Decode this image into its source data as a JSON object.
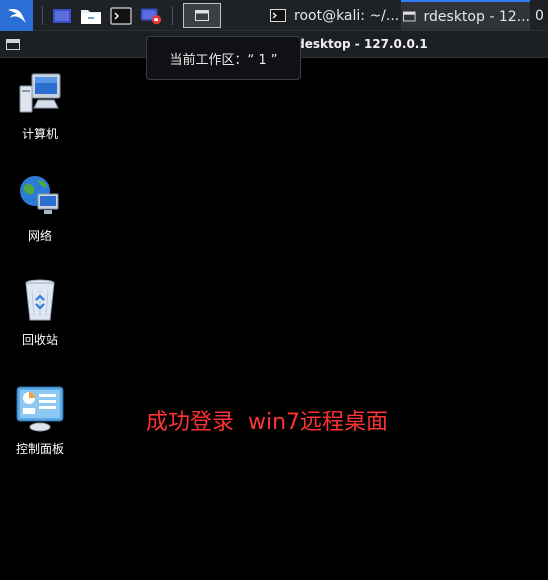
{
  "taskbar": {
    "tasks": [
      {
        "label": "root@kali: ~/..."
      },
      {
        "label": "rdesktop - 12..."
      },
      {
        "label": "0"
      }
    ]
  },
  "window": {
    "title": "rdesktop - 127.0.0.1"
  },
  "tooltip": {
    "text": "当前工作区：“ 1 ”"
  },
  "desktop": {
    "icons": [
      {
        "label": "计算机"
      },
      {
        "label": "网络"
      },
      {
        "label": "回收站"
      },
      {
        "label": "控制面板"
      }
    ],
    "annotation": "成功登录  win7远程桌面",
    "annotation_color": "#ff3333"
  },
  "colors": {
    "accent": "#2f7fff",
    "kali_blue": "#2b6fd6"
  }
}
